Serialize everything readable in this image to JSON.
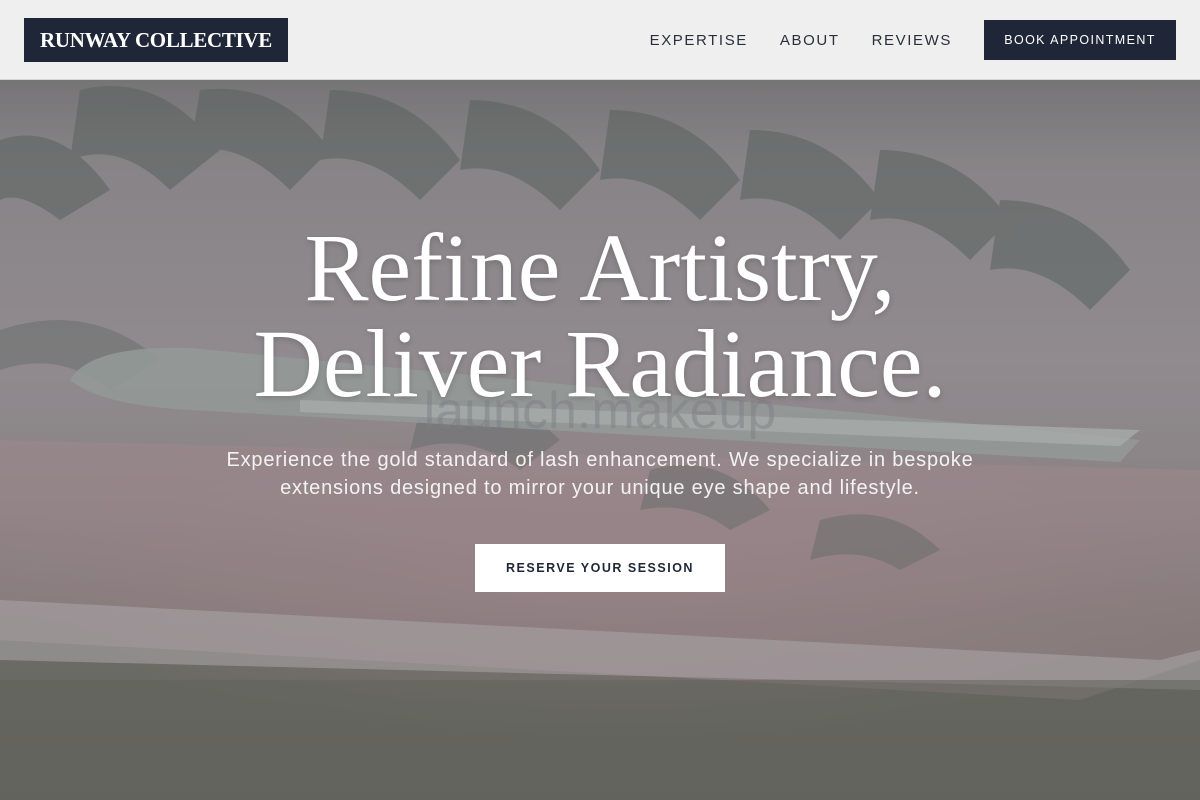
{
  "header": {
    "logo_text": "RUNWAY COLLECTIVE",
    "nav": [
      {
        "label": "EXPERTISE"
      },
      {
        "label": "ABOUT"
      },
      {
        "label": "REVIEWS"
      }
    ],
    "cta_label": "BOOK APPOINTMENT"
  },
  "hero": {
    "title_line1": "Refine Artistry,",
    "title_line2": "Deliver Radiance.",
    "subtitle": "Experience the gold standard of lash enhancement. We specialize in bespoke extensions designed to mirror your unique eye shape and lifestyle.",
    "cta_label": "RESERVE YOUR SESSION",
    "background_watermark": "launch.makeup"
  },
  "colors": {
    "brand_navy": "#1e2638",
    "header_bg": "#f5f5f5",
    "hero_text": "#ffffff",
    "button_light": "#ffffff"
  }
}
